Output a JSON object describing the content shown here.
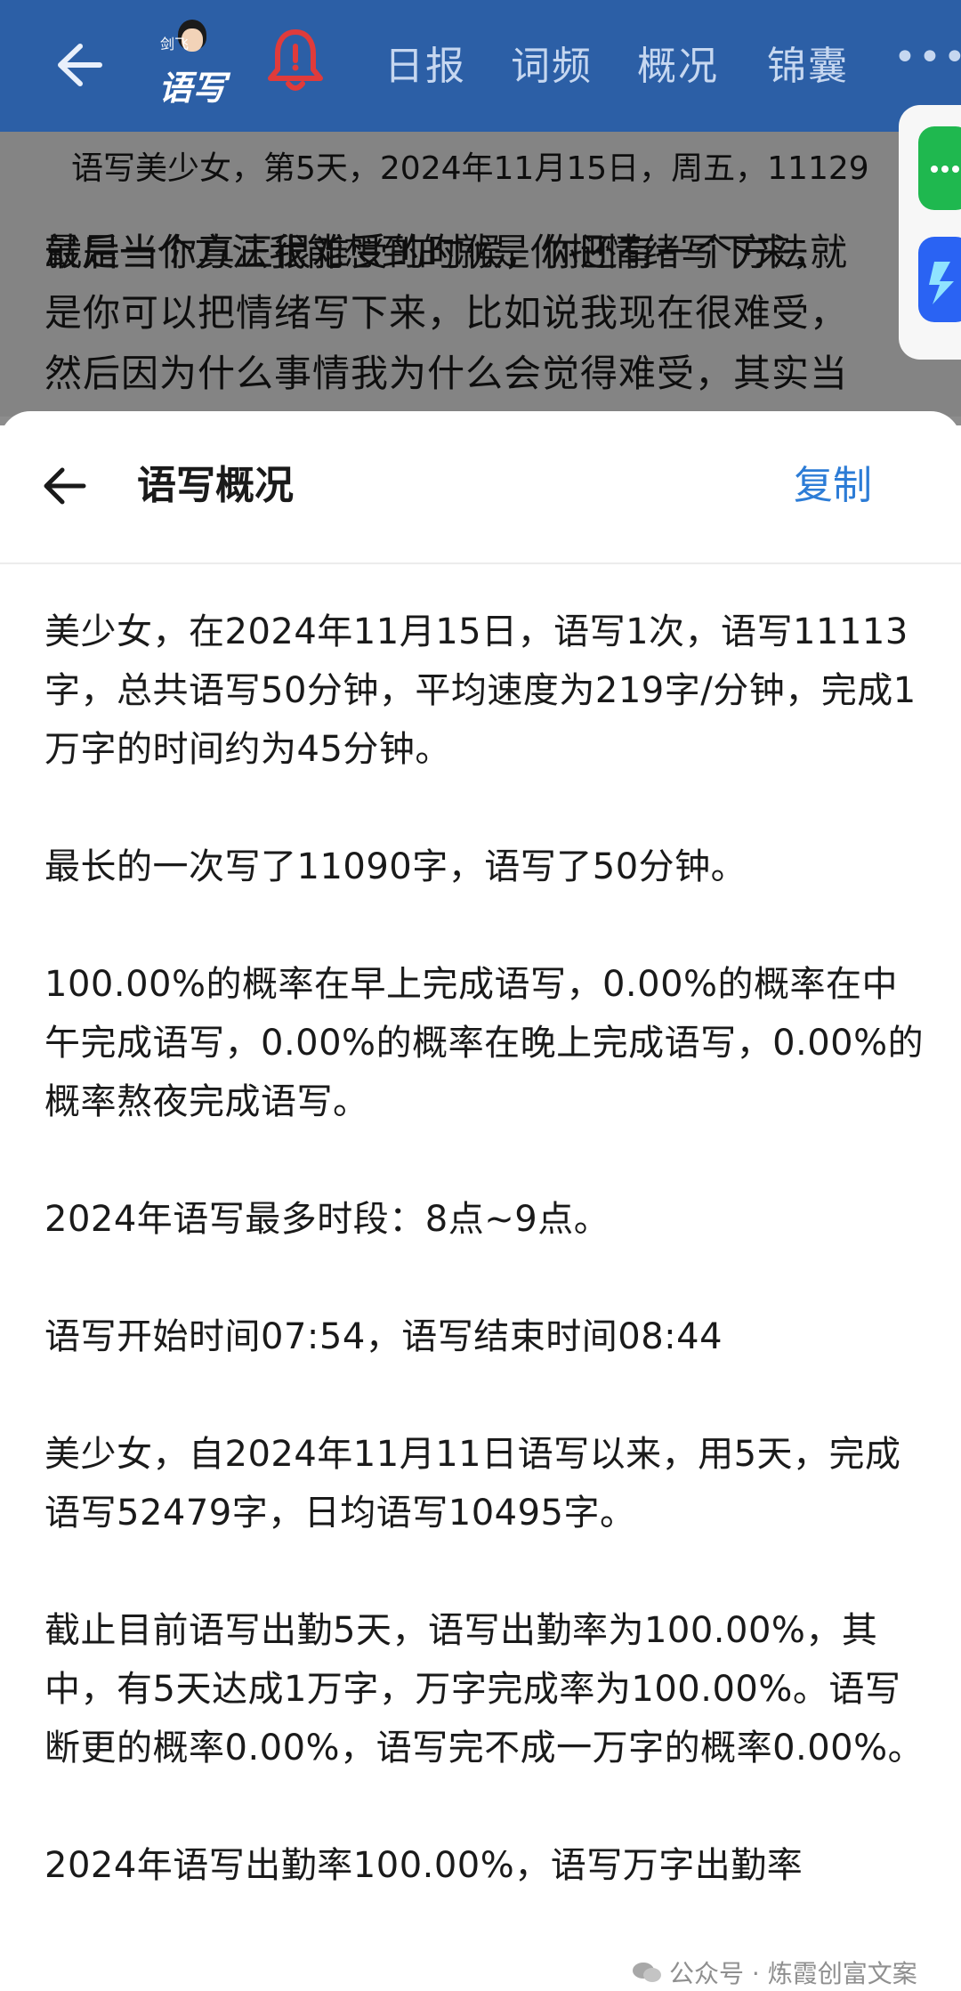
{
  "app_bar": {
    "logo_sub": "剑飞",
    "logo_main": "语写",
    "nav": {
      "daily": "日报",
      "freq": "词频",
      "overview": "概况",
      "tips": "锦囊"
    },
    "more": "•••"
  },
  "background_doc": {
    "header": "语写美少女，第5天，2024年11月15日，周五，11129",
    "lines": [
      "最后一个方法我能想到的就是你把情绪写下来，",
      "就是当你真正很难受的时候，你还有一个方法就",
      "是你可以把情绪写下来，比如说我现在很难受，",
      "然后因为什么事情我为什么会觉得难受，其实当"
    ]
  },
  "sheet": {
    "title": "语写概况",
    "copy_label": "复制",
    "paragraphs": [
      "美少女，在2024年11月15日，语写1次，语写11113字，总共语写50分钟，平均速度为219字/分钟，完成1万字的时间约为45分钟。",
      "最长的一次写了11090字，语写了50分钟。",
      "100.00%的概率在早上完成语写，0.00%的概率在中午完成语写，0.00%的概率在晚上完成语写，0.00%的概率熬夜完成语写。",
      "2024年语写最多时段：8点~9点。",
      "语写开始时间07:54，语写结束时间08:44",
      "美少女，自2024年11月11日语写以来，用5天，完成语写52479字，日均语写10495字。",
      "截止目前语写出勤5天，语写出勤率为100.00%，其中，有5天达成1万字，万字完成率为100.00%。语写断更的概率0.00%，语写完不成一万字的概率0.00%。",
      "2024年语写出勤率100.00%，语写万字出勤率"
    ]
  },
  "watermark": {
    "text": "公众号 · 炼霞创富文案"
  },
  "colors": {
    "app_bar": "#2c5fa6",
    "link": "#2c7cd6",
    "alert_bell": "#e03b3b"
  }
}
